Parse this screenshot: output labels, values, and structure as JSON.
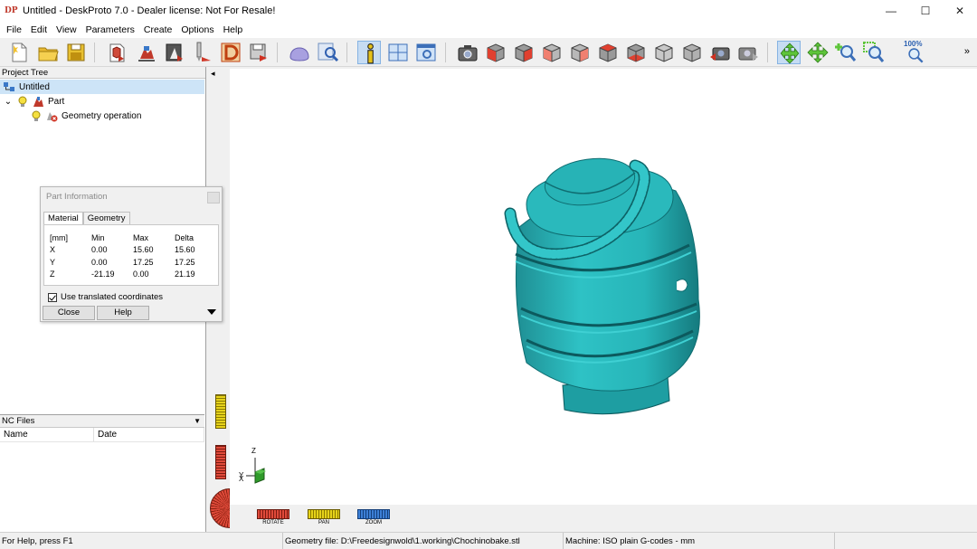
{
  "window": {
    "logo_text": "DP",
    "title": "Untitled - DeskProto 7.0 - Dealer license: Not For Resale!",
    "min_glyph": "—",
    "max_glyph": "☐",
    "close_glyph": "✕"
  },
  "menu": [
    "File",
    "Edit",
    "View",
    "Parameters",
    "Create",
    "Options",
    "Help"
  ],
  "toolbar": {
    "more_glyph": "»",
    "zoom_100_label": "100%"
  },
  "project_tree": {
    "header": "Project Tree",
    "root": "Untitled",
    "part": "Part",
    "operation": "Geometry operation",
    "expander": "⌄"
  },
  "nc_files": {
    "header": "NC Files",
    "dropdown_glyph": "▼",
    "columns": [
      "Name",
      "Date"
    ]
  },
  "splitter_arrow": "◂",
  "part_info": {
    "title": "Part Information",
    "tabs": [
      "Material",
      "Geometry"
    ],
    "columns": [
      "[mm]",
      "Min",
      "Max",
      "Delta"
    ],
    "rows": [
      [
        "X",
        "0.00",
        "15.60",
        "15.60"
      ],
      [
        "Y",
        "0.00",
        "17.25",
        "17.25"
      ],
      [
        "Z",
        "-21.19",
        "0.00",
        "21.19"
      ]
    ],
    "checkbox_label": "Use translated coordinates",
    "checkbox_checked": true,
    "close_button": "Close",
    "help_button": "Help"
  },
  "axes": {
    "z": "Z",
    "y": "Y",
    "x": "X"
  },
  "view_controls": {
    "rotate": "ROTATE",
    "pan": "PAN",
    "zoom": "ZOOM"
  },
  "status": {
    "help": "For Help, press F1",
    "geometry": "Geometry file: D:\\Freedesignwold\\1.working\\Chochinobake.stl",
    "machine": "Machine: ISO plain G-codes - mm"
  },
  "colors": {
    "model": "#27b5b8",
    "selection": "#cde4f7",
    "rotate": "#e04a3a",
    "pan": "#e6d21a",
    "zoom": "#3c7fd6",
    "accent_green": "#5ec53a"
  }
}
